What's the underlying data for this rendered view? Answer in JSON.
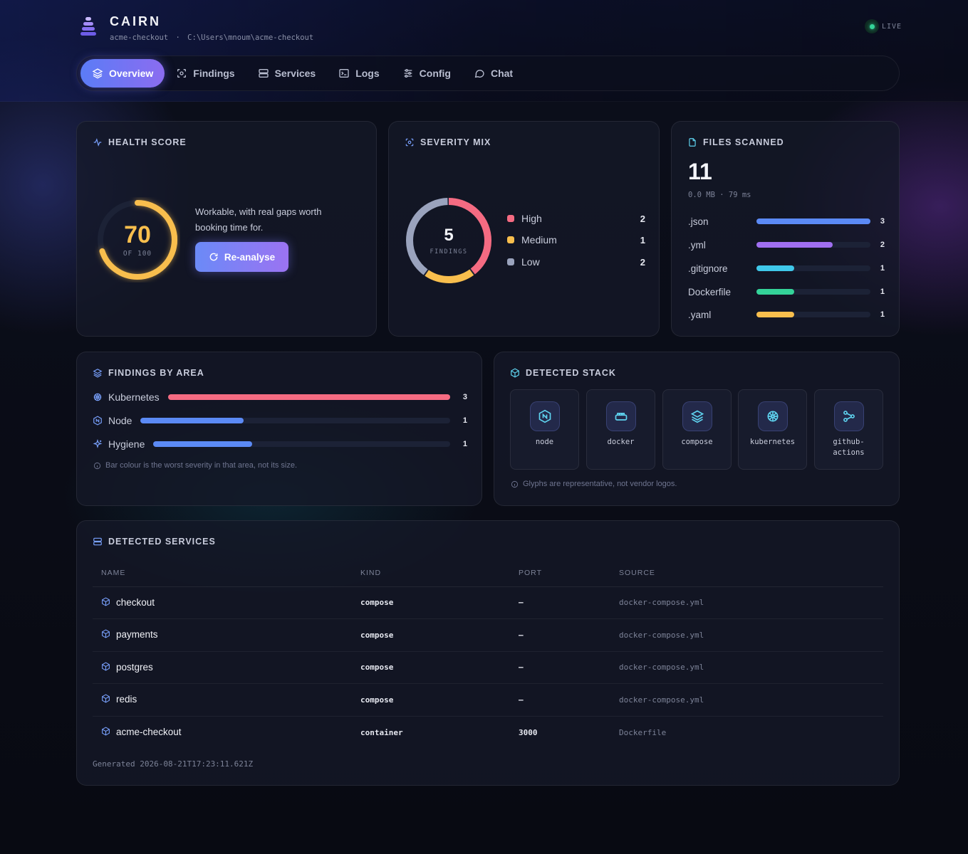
{
  "app": {
    "name": "CAIRN",
    "project": "acme-checkout",
    "separator": "·",
    "path": "C:\\Users\\mnoum\\acme-checkout",
    "status": "LIVE"
  },
  "tabs": [
    {
      "label": "Overview",
      "icon": "layers-icon",
      "active": true
    },
    {
      "label": "Findings",
      "icon": "scan-icon"
    },
    {
      "label": "Services",
      "icon": "server-icon"
    },
    {
      "label": "Logs",
      "icon": "terminal-icon"
    },
    {
      "label": "Config",
      "icon": "sliders-icon"
    },
    {
      "label": "Chat",
      "icon": "chat-icon"
    }
  ],
  "health": {
    "title": "HEALTH SCORE",
    "score": "70",
    "of": "OF 100",
    "score_fraction": 0.7,
    "summary": "Workable, with real gaps worth booking time for.",
    "button": "Re-analyse",
    "color": "#f8be4d"
  },
  "severity": {
    "title": "SEVERITY MIX",
    "total": "5",
    "total_label": "FINDINGS",
    "items": [
      {
        "label": "High",
        "count": "2",
        "value": 2,
        "color": "#f56b82"
      },
      {
        "label": "Medium",
        "count": "1",
        "value": 1,
        "color": "#f8be4d"
      },
      {
        "label": "Low",
        "count": "2",
        "value": 2,
        "color": "#9aa3bd"
      }
    ]
  },
  "files": {
    "title": "FILES SCANNED",
    "count": "11",
    "meta": "0.0 MB · 79 ms",
    "rows": [
      {
        "name": ".json",
        "count": "3",
        "value": 3,
        "color": "#5b8af5"
      },
      {
        "name": ".yml",
        "count": "2",
        "value": 2,
        "color": "#a06ff0"
      },
      {
        "name": ".gitignore",
        "count": "1",
        "value": 1,
        "color": "#3fc8ea"
      },
      {
        "name": "Dockerfile",
        "count": "1",
        "value": 1,
        "color": "#34d399"
      },
      {
        "name": ".yaml",
        "count": "1",
        "value": 1,
        "color": "#f8be4d"
      }
    ]
  },
  "areas": {
    "title": "FINDINGS BY AREA",
    "rows": [
      {
        "name": "Kubernetes",
        "count": "3",
        "value": 3,
        "color": "#f56b82",
        "icon": "helm-icon"
      },
      {
        "name": "Node",
        "count": "1",
        "value": 1,
        "color": "#5b8af5",
        "icon": "node-icon"
      },
      {
        "name": "Hygiene",
        "count": "1",
        "value": 1,
        "color": "#5b8af5",
        "icon": "sparkle-icon"
      }
    ],
    "note": "Bar colour is the worst severity in that area, not its size."
  },
  "stack": {
    "title": "DETECTED STACK",
    "items": [
      {
        "label": "node",
        "icon": "node-icon"
      },
      {
        "label": "docker",
        "icon": "docker-icon"
      },
      {
        "label": "compose",
        "icon": "layers-icon"
      },
      {
        "label": "kubernetes",
        "icon": "helm-icon"
      },
      {
        "label": "github-actions",
        "label_line1": "github-",
        "label_line2": "actions",
        "icon": "git-branch-icon"
      }
    ],
    "note": "Glyphs are representative, not vendor logos."
  },
  "services": {
    "title": "DETECTED SERVICES",
    "headers": {
      "name": "NAME",
      "kind": "KIND",
      "port": "PORT",
      "source": "SOURCE"
    },
    "rows": [
      {
        "name": "checkout",
        "kind": "compose",
        "port": "–",
        "source": "docker-compose.yml"
      },
      {
        "name": "payments",
        "kind": "compose",
        "port": "–",
        "source": "docker-compose.yml"
      },
      {
        "name": "postgres",
        "kind": "compose",
        "port": "–",
        "source": "docker-compose.yml"
      },
      {
        "name": "redis",
        "kind": "compose",
        "port": "–",
        "source": "docker-compose.yml"
      },
      {
        "name": "acme-checkout",
        "kind": "container",
        "port": "3000",
        "source": "Dockerfile"
      }
    ],
    "generated": "Generated 2026-08-21T17:23:11.621Z"
  }
}
